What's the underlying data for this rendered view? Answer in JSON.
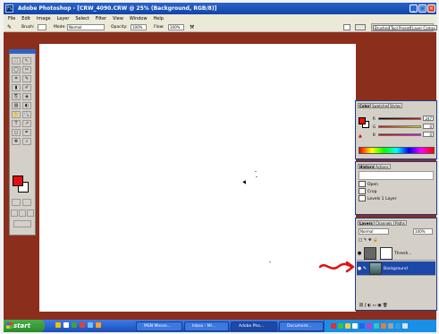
{
  "window": {
    "title": "Adobe Photoshop - [CRW_4090.CRW @ 25% (Background, RGB/8)]",
    "app_icon_label": "Ps",
    "controls": {
      "minimize": "_",
      "maximize": "□",
      "close": "×"
    }
  },
  "menubar": {
    "items": [
      "File",
      "Edit",
      "Image",
      "Layer",
      "Select",
      "Filter",
      "View",
      "Window",
      "Help"
    ]
  },
  "options": {
    "brush_label": "Brush:",
    "mode_label": "Mode:",
    "mode_value": "Normal",
    "opacity_label": "Opacity:",
    "opacity_value": "100%",
    "flow_label": "Flow:",
    "flow_value": "100%",
    "palette_tabs": [
      "Brushes",
      "Tool Presets",
      "Layer Comps"
    ]
  },
  "toolbox": {
    "tools": [
      "⬚",
      "↖",
      "◯",
      "✂",
      "⌗",
      "✎",
      "▮",
      "✐",
      "⎘",
      "◈",
      "▨",
      "◐",
      "✋",
      "🔍",
      "T",
      "↗",
      "◻",
      "✒",
      "✥",
      "⌕"
    ],
    "foreground_color": "#e01010",
    "background_color": "#ffffff"
  },
  "color_palette": {
    "tabs": [
      "Color",
      "Swatches",
      "Styles"
    ],
    "channels": [
      {
        "label": "R",
        "value": "247"
      },
      {
        "label": "G",
        "value": "0"
      },
      {
        "label": "B",
        "value": "0"
      }
    ]
  },
  "history_palette": {
    "tabs": [
      "History",
      "Actions"
    ],
    "items": [
      "Open",
      "Crop",
      "Levels 1 Layer"
    ]
  },
  "layers_palette": {
    "tabs": [
      "Layers",
      "Channels",
      "Paths"
    ],
    "blend_mode": "Normal",
    "opacity": "100%",
    "layers": [
      {
        "name": "Thresh...",
        "selected": false
      },
      {
        "name": "Background",
        "selected": true
      }
    ]
  },
  "taskbar": {
    "start_label": "start",
    "tasks": [
      {
        "label": "MSN Messe...",
        "active": false
      },
      {
        "label": "Inbox - Mi...",
        "active": false
      },
      {
        "label": "Adobe Pho...",
        "active": true
      },
      {
        "label": "Document...",
        "active": false
      }
    ]
  },
  "colors": {
    "workspace": "#8c2e1c",
    "title_bar": "#2a64c8",
    "annotation_arrow": "#e01010"
  }
}
